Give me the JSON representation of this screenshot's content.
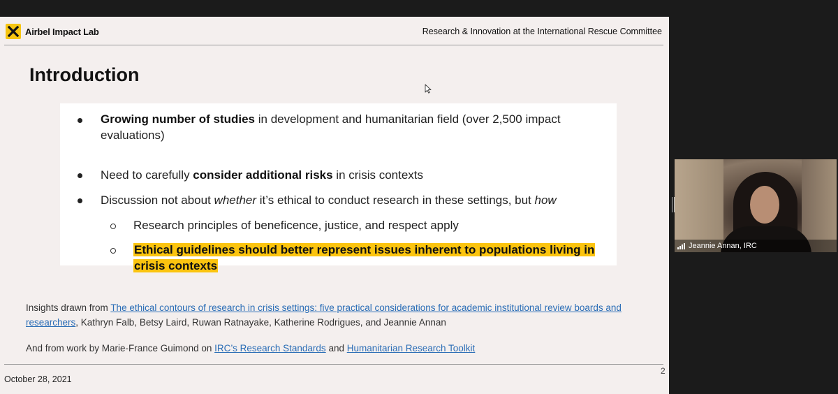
{
  "header": {
    "brand": "Airbel Impact Lab",
    "subtitle": "Research & Innovation at the International Rescue Committee"
  },
  "slide": {
    "title": "Introduction",
    "bullets": [
      {
        "bold": "Growing number of studies",
        "rest_line1": " in development and humanitarian field (over 2,500 impact",
        "rest_line2": "evaluations)"
      },
      {
        "pre": "Need to carefully ",
        "bold": "consider additional risks",
        "post": " in crisis contexts"
      },
      {
        "pre": "Discussion  not about ",
        "em1": "whether",
        "mid": " it’s ethical to conduct research in these settings, but ",
        "em2": "how"
      }
    ],
    "sub_bullets": [
      "Research principles of beneficence, justice, and respect apply",
      "Ethical guidelines should better represent issues inherent to populations living in crisis contexts"
    ]
  },
  "references": {
    "insights_prefix": "Insights drawn from ",
    "insights_link": "The ethical contours of research in crisis settings: five practical considerations for academic institutional review boards and researchers",
    "insights_authors": ", Kathryn Falb, Betsy Laird, Ruwan Ratnayake, Katherine Rodrigues, and Jeannie Annan",
    "work_prefix": "And from work by Marie-France Guimond on ",
    "link1": "IRC’s Research Standards",
    "and_text": " and ",
    "link2": "Humanitarian Research Toolkit"
  },
  "footer": {
    "date": "October 28, 2021",
    "page_number": "2"
  },
  "video": {
    "participant_name": "Jeannie Annan, IRC"
  },
  "colors": {
    "brand_yellow": "#f6c511",
    "highlight": "#fbc40f",
    "link": "#2a6db6",
    "slide_bg": "#f4efee"
  }
}
